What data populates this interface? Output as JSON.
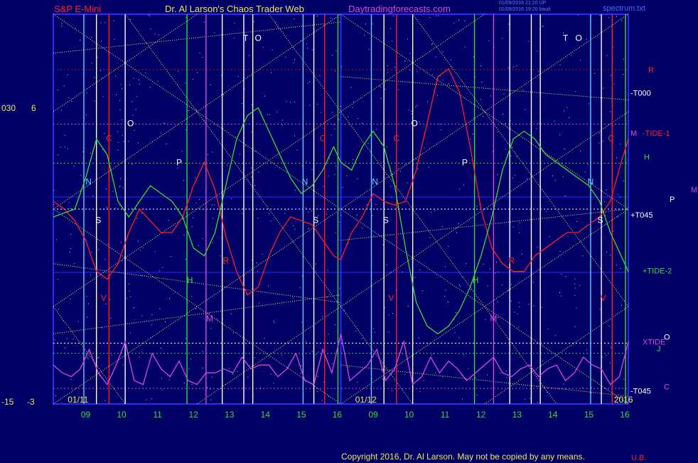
{
  "header": {
    "symbol": "S&P E-Mini",
    "author": "Dr. Al Larson's Chaos Trader Web",
    "site": "Daytradingforecasts.com",
    "stamp1": "01/09/2016 21:20 UP",
    "stamp2": "01/09/2016 19:20 baud",
    "file": "spectrum.txt"
  },
  "footer": {
    "copyright": "Copyright 2016, Dr. Al Larson. May not be copied by any means.",
    "corner": "U.B."
  },
  "left_axis": {
    "top_a": "030",
    "top_b": "6",
    "bottom_a": "-15",
    "bottom_b": "-3"
  },
  "colors": {
    "background": "#000066",
    "frame": "#2a2aff",
    "cyan": "#66ccff",
    "white": "#ffffff",
    "red": "#ff2020",
    "green": "#33dd33",
    "magenta": "#dd44dd",
    "yellow": "#eeee55",
    "darkred": "#aa2222"
  },
  "chart_data": {
    "type": "line",
    "x_range": [
      0,
      16
    ],
    "y_range": [
      0,
      100
    ],
    "date_marks": [
      {
        "label": "01/11",
        "x": 0.4
      },
      {
        "label": "01/12",
        "x": 8.4
      },
      {
        "label": "2016",
        "x": 15.6
      }
    ],
    "x_ticks": [
      {
        "label": "09",
        "x": 0.9,
        "color": "green"
      },
      {
        "label": "10",
        "x": 1.9,
        "color": "green"
      },
      {
        "label": "11",
        "x": 2.9,
        "color": "green"
      },
      {
        "label": "12",
        "x": 3.9,
        "color": "green"
      },
      {
        "label": "13",
        "x": 4.9,
        "color": "green"
      },
      {
        "label": "14",
        "x": 5.9,
        "color": "green"
      },
      {
        "label": "15",
        "x": 6.9,
        "color": "green"
      },
      {
        "label": "16",
        "x": 7.9,
        "color": "green"
      },
      {
        "label": "09",
        "x": 8.9,
        "color": "green"
      },
      {
        "label": "10",
        "x": 9.9,
        "color": "green"
      },
      {
        "label": "11",
        "x": 10.9,
        "color": "green"
      },
      {
        "label": "12",
        "x": 11.9,
        "color": "green"
      },
      {
        "label": "13",
        "x": 12.9,
        "color": "green"
      },
      {
        "label": "14",
        "x": 13.9,
        "color": "green"
      },
      {
        "label": "15",
        "x": 14.9,
        "color": "green"
      },
      {
        "label": "16",
        "x": 15.9,
        "color": "green"
      }
    ],
    "right_labels": [
      {
        "label": "R",
        "y": 85.8,
        "color": "red",
        "dx": 28
      },
      {
        "label": "-T000",
        "y": 79.8,
        "color": "white",
        "dx": 3
      },
      {
        "label": "M",
        "y": 69.5,
        "color": "magenta",
        "dx": 3
      },
      {
        "label": "-TIDE-1",
        "y": 69.5,
        "color": "red",
        "dx": 20
      },
      {
        "label": "H",
        "y": 63.4,
        "color": "green",
        "dx": 22
      },
      {
        "label": "P",
        "y": 52.6,
        "color": "white",
        "dx": 58
      },
      {
        "label": "M",
        "y": 55.0,
        "color": "magenta",
        "dx": 88
      },
      {
        "label": "+T045",
        "y": 48.5,
        "color": "white",
        "dx": 3
      },
      {
        "label": "+TIDE-2",
        "y": 34.2,
        "color": "green",
        "dx": 20
      },
      {
        "label": "XTIDE",
        "y": 16.0,
        "color": "magenta",
        "dx": 20
      },
      {
        "label": "O",
        "y": 17.2,
        "color": "white",
        "dx": 50
      },
      {
        "label": "J",
        "y": 14.2,
        "color": "green",
        "dx": 40
      },
      {
        "label": "C",
        "y": 4.5,
        "color": "magenta",
        "dx": 50
      },
      {
        "label": "-T045",
        "y": 3.4,
        "color": "white",
        "dx": 3
      }
    ],
    "verticals": [
      {
        "x": 0.85,
        "color": "cyan"
      },
      {
        "x": 1.2,
        "color": "white"
      },
      {
        "x": 1.55,
        "color": "red"
      },
      {
        "x": 2.0,
        "color": "white"
      },
      {
        "x": 3.72,
        "color": "green"
      },
      {
        "x": 4.25,
        "color": "magenta"
      },
      {
        "x": 4.7,
        "color": "white"
      },
      {
        "x": 5.3,
        "color": "white"
      },
      {
        "x": 5.55,
        "color": "white"
      },
      {
        "x": 6.95,
        "color": "cyan"
      },
      {
        "x": 7.25,
        "color": "white"
      },
      {
        "x": 7.55,
        "color": "red"
      },
      {
        "x": 7.92,
        "color": "green"
      },
      {
        "x": 8.85,
        "color": "cyan"
      },
      {
        "x": 9.2,
        "color": "white"
      },
      {
        "x": 9.55,
        "color": "red"
      },
      {
        "x": 10.0,
        "color": "white"
      },
      {
        "x": 11.72,
        "color": "green"
      },
      {
        "x": 12.25,
        "color": "magenta"
      },
      {
        "x": 12.7,
        "color": "white"
      },
      {
        "x": 13.3,
        "color": "white"
      },
      {
        "x": 13.55,
        "color": "white"
      },
      {
        "x": 14.95,
        "color": "cyan"
      },
      {
        "x": 15.25,
        "color": "white"
      },
      {
        "x": 15.55,
        "color": "red"
      },
      {
        "x": 15.92,
        "color": "green"
      }
    ],
    "horizontals": [
      {
        "y": 85.8,
        "color": "darkred"
      },
      {
        "y": 71.8,
        "color": "magenta"
      },
      {
        "y": 61.8,
        "color": "green"
      },
      {
        "y": 50.0,
        "color": "white"
      },
      {
        "y": 15.6,
        "color": "white"
      },
      {
        "y": 13.0,
        "color": "green"
      },
      {
        "y": 4.0,
        "color": "magenta"
      }
    ],
    "diagonals": [
      {
        "x1": 0,
        "y1": 100,
        "x2": 16,
        "y2": 0
      },
      {
        "x1": 0,
        "y1": 0,
        "x2": 16,
        "y2": 100
      },
      {
        "x1": 0,
        "y1": 75,
        "x2": 4,
        "y2": 100
      },
      {
        "x1": 0,
        "y1": 25,
        "x2": 12,
        "y2": 100
      },
      {
        "x1": 4,
        "y1": 0,
        "x2": 16,
        "y2": 75
      },
      {
        "x1": 12,
        "y1": 0,
        "x2": 16,
        "y2": 25
      },
      {
        "x1": 0,
        "y1": 50,
        "x2": 8,
        "y2": 0
      },
      {
        "x1": 8,
        "y1": 100,
        "x2": 16,
        "y2": 50
      },
      {
        "x1": 0,
        "y1": 50,
        "x2": 8,
        "y2": 100
      },
      {
        "x1": 8,
        "y1": 0,
        "x2": 16,
        "y2": 50
      },
      {
        "x1": 2,
        "y1": 100,
        "x2": 10,
        "y2": 0
      },
      {
        "x1": 6,
        "y1": 100,
        "x2": 14,
        "y2": 0
      },
      {
        "x1": 10,
        "y1": 100,
        "x2": 16,
        "y2": 25
      },
      {
        "x1": 0,
        "y1": 25,
        "x2": 2,
        "y2": 0
      },
      {
        "x1": 0,
        "y1": 90,
        "x2": 8,
        "y2": 98
      },
      {
        "x1": 0,
        "y1": 36,
        "x2": 8,
        "y2": 26
      },
      {
        "x1": 0,
        "y1": 18,
        "x2": 8,
        "y2": 28
      },
      {
        "x1": 8,
        "y1": 84,
        "x2": 16,
        "y2": 78
      },
      {
        "x1": 8,
        "y1": 42,
        "x2": 16,
        "y2": 50
      },
      {
        "x1": 8,
        "y1": 10,
        "x2": 16,
        "y2": 2
      }
    ],
    "series": [
      {
        "name": "red",
        "color": "red",
        "x": [
          0,
          0.3,
          0.6,
          0.9,
          1.2,
          1.5,
          1.8,
          2.1,
          2.4,
          2.7,
          3.0,
          3.3,
          3.6,
          3.9,
          4.2,
          4.5,
          4.8,
          5.1,
          5.4,
          5.7,
          6.0,
          6.3,
          6.6,
          6.9,
          7.2,
          7.5,
          7.8,
          8.0,
          8.3,
          8.6,
          8.9,
          9.2,
          9.5,
          9.8,
          10.1,
          10.4,
          10.7,
          11.0,
          11.3,
          11.6,
          11.9,
          12.2,
          12.5,
          12.8,
          13.1,
          13.4,
          13.7,
          14.0,
          14.3,
          14.6,
          14.9,
          15.2,
          15.5,
          15.8,
          16.0
        ],
        "y": [
          52,
          50,
          47,
          42,
          34,
          32,
          36,
          44,
          50,
          47,
          44,
          44,
          48,
          56,
          62,
          55,
          43,
          34,
          28,
          30,
          38,
          44,
          48,
          47,
          46,
          42,
          38,
          37,
          44,
          48,
          54,
          52,
          51,
          52,
          60,
          72,
          84,
          86,
          80,
          66,
          50,
          40,
          36,
          34,
          34,
          38,
          40,
          42,
          44,
          44,
          46,
          48,
          52,
          62,
          68
        ]
      },
      {
        "name": "green",
        "color": "green",
        "x": [
          0,
          0.3,
          0.6,
          0.9,
          1.2,
          1.5,
          1.8,
          2.1,
          2.4,
          2.7,
          3.0,
          3.3,
          3.6,
          3.9,
          4.2,
          4.5,
          4.8,
          5.1,
          5.4,
          5.7,
          6.0,
          6.3,
          6.6,
          6.9,
          7.2,
          7.5,
          7.8,
          8.0,
          8.3,
          8.6,
          8.9,
          9.2,
          9.5,
          9.8,
          10.1,
          10.4,
          10.7,
          11.0,
          11.3,
          11.6,
          11.9,
          12.2,
          12.5,
          12.8,
          13.1,
          13.4,
          13.7,
          14.0,
          14.3,
          14.6,
          14.9,
          15.2,
          15.5,
          15.8,
          16.0
        ],
        "y": [
          48,
          49,
          50,
          58,
          68,
          64,
          52,
          48,
          52,
          56,
          54,
          52,
          48,
          40,
          38,
          44,
          56,
          68,
          74,
          76,
          70,
          64,
          58,
          54,
          56,
          60,
          66,
          62,
          60,
          66,
          70,
          66,
          56,
          40,
          26,
          20,
          18,
          20,
          24,
          30,
          38,
          48,
          60,
          68,
          70,
          68,
          64,
          62,
          60,
          58,
          56,
          52,
          44,
          38,
          34
        ]
      },
      {
        "name": "magenta",
        "color": "magenta",
        "x": [
          0,
          0.25,
          0.5,
          0.75,
          1.0,
          1.25,
          1.5,
          1.75,
          2.0,
          2.25,
          2.5,
          2.75,
          3.0,
          3.25,
          3.5,
          3.75,
          4.0,
          4.25,
          4.5,
          4.75,
          5.0,
          5.25,
          5.5,
          5.75,
          6.0,
          6.25,
          6.5,
          6.75,
          7.0,
          7.25,
          7.5,
          7.75,
          8.0,
          8.25,
          8.5,
          8.75,
          9.0,
          9.25,
          9.5,
          9.75,
          10.0,
          10.25,
          10.5,
          10.75,
          11.0,
          11.25,
          11.5,
          11.75,
          12.0,
          12.25,
          12.5,
          12.75,
          13.0,
          13.25,
          13.5,
          13.75,
          14.0,
          14.25,
          14.5,
          14.75,
          15.0,
          15.25,
          15.5,
          15.75,
          16.0
        ],
        "y": [
          10,
          8,
          7,
          9,
          14,
          8,
          5,
          10,
          16,
          6,
          5,
          13,
          9,
          7,
          11,
          6,
          5,
          8,
          8,
          9,
          8,
          12,
          9,
          10,
          10,
          7,
          9,
          13,
          6,
          5,
          14,
          8,
          18,
          6,
          8,
          10,
          14,
          6,
          9,
          16,
          5,
          7,
          12,
          8,
          11,
          9,
          6,
          8,
          10,
          12,
          8,
          7,
          9,
          10,
          7,
          9,
          10,
          6,
          8,
          12,
          10,
          9,
          5,
          7,
          16
        ]
      }
    ],
    "series_labels": [
      {
        "text": "T",
        "x": 5.35,
        "y": 93.2,
        "color": "white"
      },
      {
        "text": "O",
        "x": 5.7,
        "y": 93.2,
        "color": "white"
      },
      {
        "text": "T",
        "x": 14.25,
        "y": 93.2,
        "color": "white"
      },
      {
        "text": "O",
        "x": 14.62,
        "y": 93.2,
        "color": "white"
      },
      {
        "text": "O",
        "x": 2.15,
        "y": 71.3,
        "color": "white"
      },
      {
        "text": "O",
        "x": 10.05,
        "y": 71.3,
        "color": "white"
      },
      {
        "text": "C",
        "x": 1.55,
        "y": 67.4,
        "color": "red"
      },
      {
        "text": "C",
        "x": 7.5,
        "y": 67.4,
        "color": "red"
      },
      {
        "text": "C",
        "x": 9.55,
        "y": 67.4,
        "color": "red"
      },
      {
        "text": "C",
        "x": 15.52,
        "y": 67.4,
        "color": "red"
      },
      {
        "text": "P",
        "x": 3.5,
        "y": 61.2,
        "color": "white"
      },
      {
        "text": "P",
        "x": 11.45,
        "y": 61.2,
        "color": "white"
      },
      {
        "text": "N",
        "x": 0.98,
        "y": 56.3,
        "color": "cyan"
      },
      {
        "text": "N",
        "x": 7.0,
        "y": 56.3,
        "color": "cyan"
      },
      {
        "text": "N",
        "x": 8.95,
        "y": 56.3,
        "color": "cyan"
      },
      {
        "text": "N",
        "x": 14.95,
        "y": 56.3,
        "color": "cyan"
      },
      {
        "text": "S",
        "x": 1.25,
        "y": 46.4,
        "color": "white"
      },
      {
        "text": "S",
        "x": 7.3,
        "y": 46.4,
        "color": "white"
      },
      {
        "text": "S",
        "x": 9.25,
        "y": 46.4,
        "color": "white"
      },
      {
        "text": "S",
        "x": 15.22,
        "y": 46.4,
        "color": "white"
      },
      {
        "text": "R",
        "x": 4.8,
        "y": 36.0,
        "color": "red"
      },
      {
        "text": "R",
        "x": 12.75,
        "y": 36.0,
        "color": "red"
      },
      {
        "text": "H",
        "x": 3.8,
        "y": 31.0,
        "color": "green"
      },
      {
        "text": "H",
        "x": 11.75,
        "y": 31.0,
        "color": "green"
      },
      {
        "text": "M",
        "x": 4.35,
        "y": 21.2,
        "color": "magenta"
      },
      {
        "text": "M",
        "x": 12.25,
        "y": 21.2,
        "color": "magenta"
      },
      {
        "text": "V",
        "x": 1.4,
        "y": 26.5,
        "color": "red"
      },
      {
        "text": "V",
        "x": 9.4,
        "y": 26.5,
        "color": "red"
      },
      {
        "text": "V",
        "x": 15.3,
        "y": 26.5,
        "color": "red"
      }
    ]
  }
}
